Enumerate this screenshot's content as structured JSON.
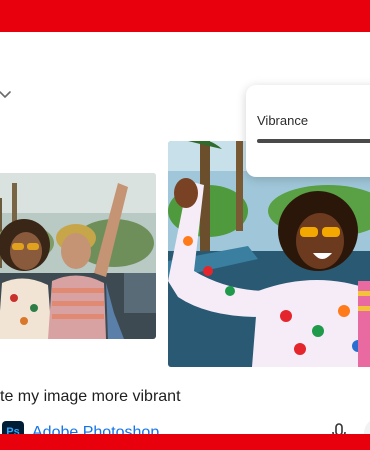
{
  "popover": {
    "label": "Vibrance",
    "level": 1.0
  },
  "prompt": {
    "text": "te my image more vibrant"
  },
  "app": {
    "name": "Adobe Photoshop",
    "logo_text": "Ps"
  },
  "icons": {
    "top_left": "chevron-down-icon",
    "mic": "microphone-icon",
    "app_logo": "photoshop-logo"
  },
  "colors": {
    "brand_red": "#e8000d",
    "photoshop_blue": "#1473e6",
    "ps_logo_bg": "#001e36",
    "ps_logo_fg": "#31a8ff"
  }
}
